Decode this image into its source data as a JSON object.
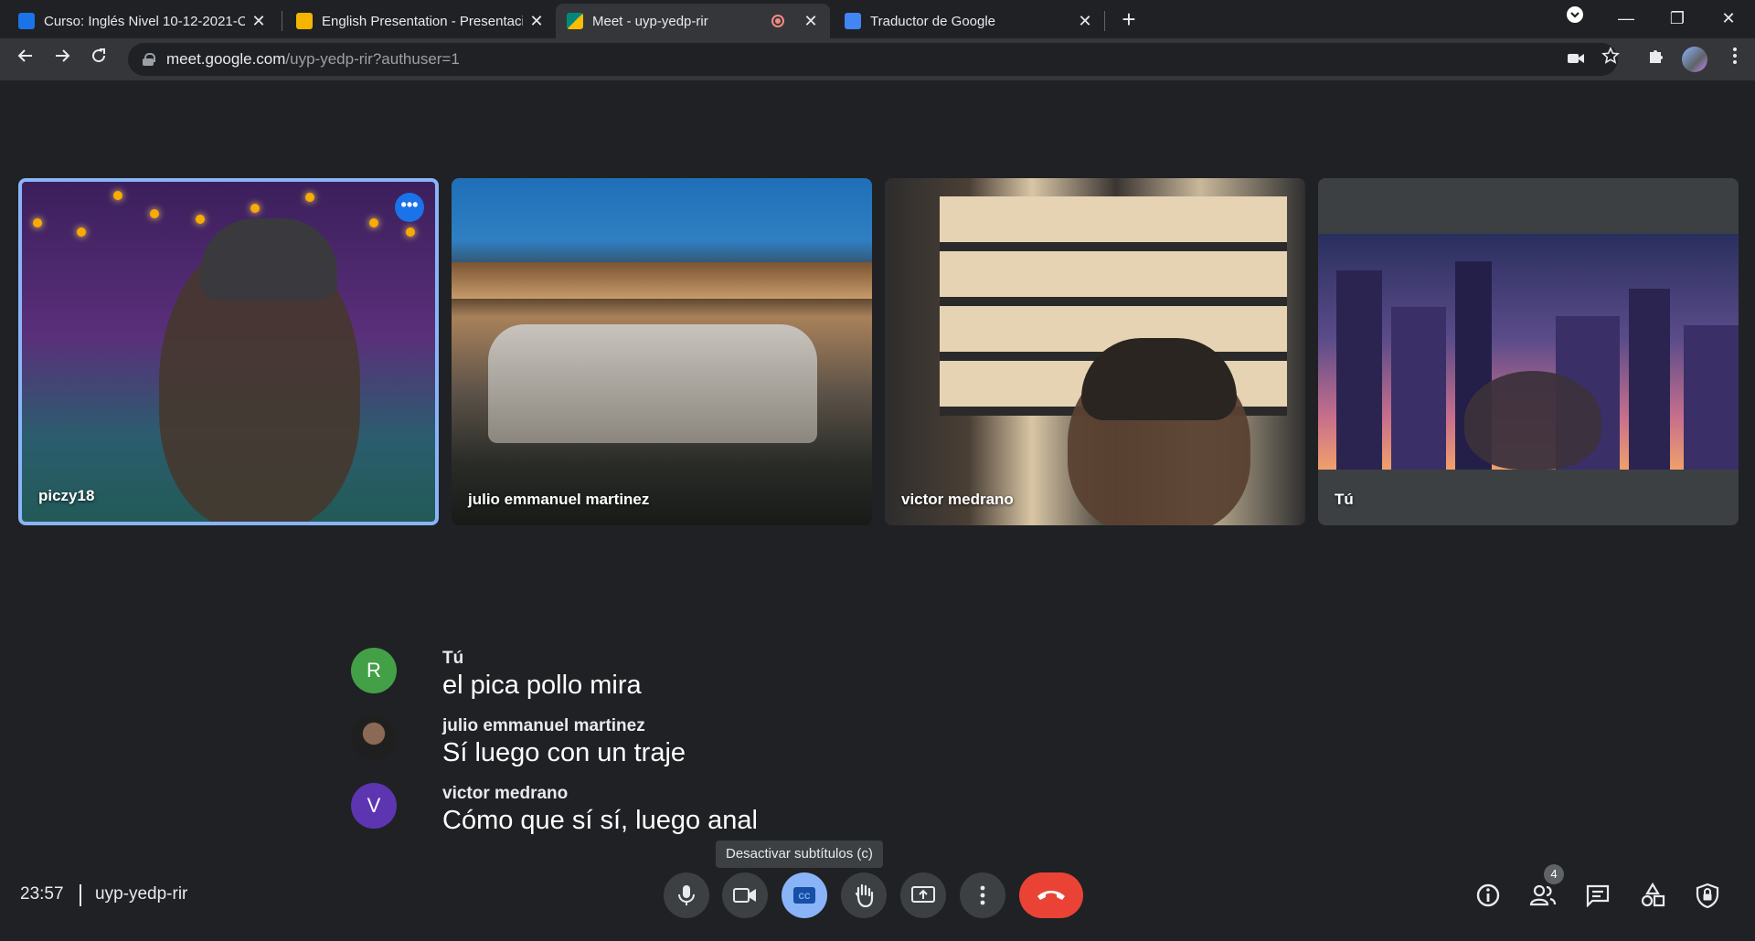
{
  "browser": {
    "tabs": [
      {
        "title": "Curso: Inglés Nivel 10-12-2021-C",
        "favicon_color": "#1a73e8"
      },
      {
        "title": "English Presentation - Presentaci",
        "favicon_color": "#f4b400"
      },
      {
        "title": "Meet - uyp-yedp-rir",
        "favicon_color": "#00897b",
        "active": true,
        "recording": true
      },
      {
        "title": "Traductor de Google",
        "favicon_color": "#4285f4"
      }
    ],
    "url_host": "meet.google.com",
    "url_path": "/uyp-yedp-rir?authuser=1"
  },
  "tiles": [
    {
      "name": "piczy18",
      "highlighted": true
    },
    {
      "name": "julio emmanuel martinez"
    },
    {
      "name": "victor medrano"
    },
    {
      "name": "Tú"
    }
  ],
  "captions": [
    {
      "avatar": "R",
      "avatar_color": "#43a047",
      "speaker": "Tú",
      "text": "el pica pollo mira"
    },
    {
      "avatar": "",
      "avatar_color": "#3c3c3c",
      "speaker": "julio emmanuel martinez",
      "text": "Sí luego con un traje"
    },
    {
      "avatar": "V",
      "avatar_color": "#5e35b1",
      "speaker": "victor medrano",
      "text": "Cómo que sí sí, luego anal"
    }
  ],
  "tooltip": "Desactivar subtítulos (c)",
  "bottom": {
    "time": "23:57",
    "meeting_code": "uyp-yedp-rir",
    "participants_count": "4"
  },
  "colors": {
    "accent": "#8ab4f8",
    "hangup": "#ea4335",
    "background": "#202124"
  }
}
